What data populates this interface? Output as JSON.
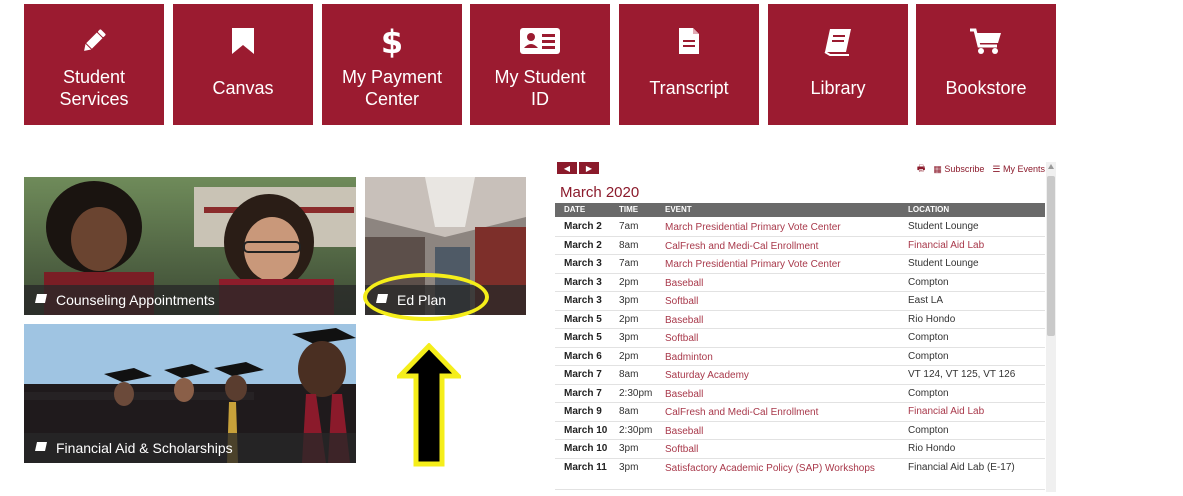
{
  "tiles": [
    {
      "label": "Student\nServices",
      "icon": "pencil-icon"
    },
    {
      "label": "Canvas",
      "icon": "bookmark-icon"
    },
    {
      "label": "My Payment\nCenter",
      "icon": "dollar-icon"
    },
    {
      "label": "My Student\nID",
      "icon": "id-card-icon"
    },
    {
      "label": "Transcript",
      "icon": "document-icon"
    },
    {
      "label": "Library",
      "icon": "book-icon"
    },
    {
      "label": "Bookstore",
      "icon": "cart-icon"
    }
  ],
  "cards": {
    "counseling": "Counseling Appointments",
    "ed_plan": "Ed Plan",
    "financial_aid": "Financial Aid & Scholarships"
  },
  "calendar": {
    "nav_prev": "◀",
    "nav_next": "▶",
    "subscribe": "Subscribe",
    "my_events": "My Events",
    "month": "March 2020",
    "headers": {
      "date": "DATE",
      "time": "TIME",
      "event": "EVENT",
      "location": "LOCATION"
    },
    "rows": [
      {
        "date": "March 2",
        "time": "7am",
        "event": "March Presidential Primary Vote Center",
        "location": "Student Lounge"
      },
      {
        "date": "March 2",
        "time": "8am",
        "event": "CalFresh and Medi-Cal Enrollment",
        "location": "Financial Aid Lab"
      },
      {
        "date": "March 3",
        "time": "7am",
        "event": "March Presidential Primary Vote Center",
        "location": "Student Lounge"
      },
      {
        "date": "March 3",
        "time": "2pm",
        "event": "Baseball",
        "location": "Compton"
      },
      {
        "date": "March 3",
        "time": "3pm",
        "event": "Softball",
        "location": "East LA"
      },
      {
        "date": "March 5",
        "time": "2pm",
        "event": "Baseball",
        "location": "Rio Hondo"
      },
      {
        "date": "March 5",
        "time": "3pm",
        "event": "Softball",
        "location": "Compton"
      },
      {
        "date": "March 6",
        "time": "2pm",
        "event": "Badminton",
        "location": "Compton"
      },
      {
        "date": "March 7",
        "time": "8am",
        "event": "Saturday Academy",
        "location": "VT 124, VT 125, VT 126"
      },
      {
        "date": "March 7",
        "time": "2:30pm",
        "event": "Baseball",
        "location": "Compton"
      },
      {
        "date": "March 9",
        "time": "8am",
        "event": "CalFresh and Medi-Cal Enrollment",
        "location": "Financial Aid Lab"
      },
      {
        "date": "March 10",
        "time": "2:30pm",
        "event": "Baseball",
        "location": "Compton"
      },
      {
        "date": "March 10",
        "time": "3pm",
        "event": "Softball",
        "location": "Rio Hondo"
      },
      {
        "date": "March 11",
        "time": "3pm",
        "event": "Satisfactory Academic Policy (SAP) Workshops",
        "location": "Financial Aid Lab (E-17)"
      }
    ]
  },
  "colors": {
    "brand": "#9b1b30",
    "highlight": "#f5ee1a",
    "arrow_fill": "#000000"
  }
}
